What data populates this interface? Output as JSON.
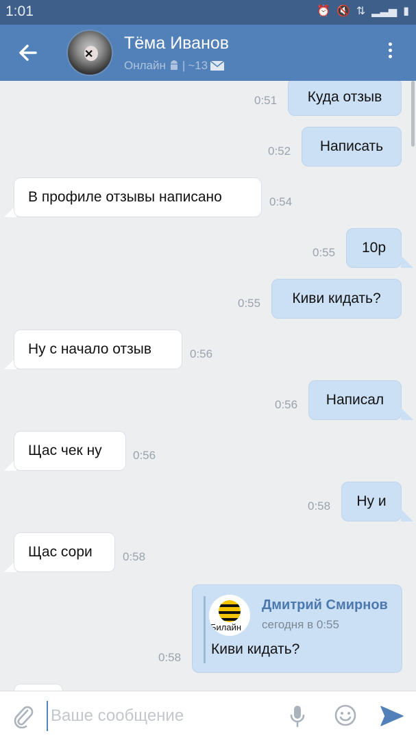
{
  "status_bar": {
    "time": "1:01",
    "icons": [
      "alarm-icon",
      "mute-icon",
      "network-icon",
      "signal-icon",
      "battery-icon"
    ]
  },
  "header": {
    "contact_name": "Тёма Иванов",
    "status_text": "Онлайн",
    "separator": "|",
    "last_seen": "~13",
    "accent_color": "#5181b8"
  },
  "messages": [
    {
      "direction": "out",
      "text": "Куда отзыв",
      "time": "0:51"
    },
    {
      "direction": "out",
      "text": "Написать",
      "time": "0:52"
    },
    {
      "direction": "in",
      "text": "В профиле отзывы написано",
      "time": "0:54"
    },
    {
      "direction": "out",
      "text": "10р",
      "time": "0:55"
    },
    {
      "direction": "out",
      "text": "Киви кидать?",
      "time": "0:55"
    },
    {
      "direction": "in",
      "text": "Ну с начало отзыв",
      "time": "0:56"
    },
    {
      "direction": "out",
      "text": "Написал",
      "time": "0:56"
    },
    {
      "direction": "in",
      "text": "Щас чек ну",
      "time": "0:56"
    },
    {
      "direction": "out",
      "text": "Ну и",
      "time": "0:58"
    },
    {
      "direction": "in",
      "text": "Щас сори",
      "time": "0:58"
    }
  ],
  "forwarded": {
    "time": "0:58",
    "author": "Дмитрий Смирнов",
    "date": "сегодня в 0:55",
    "text": "Киви кидать?",
    "avatar_label": "Билайн"
  },
  "input": {
    "placeholder": "Ваше сообщение"
  }
}
